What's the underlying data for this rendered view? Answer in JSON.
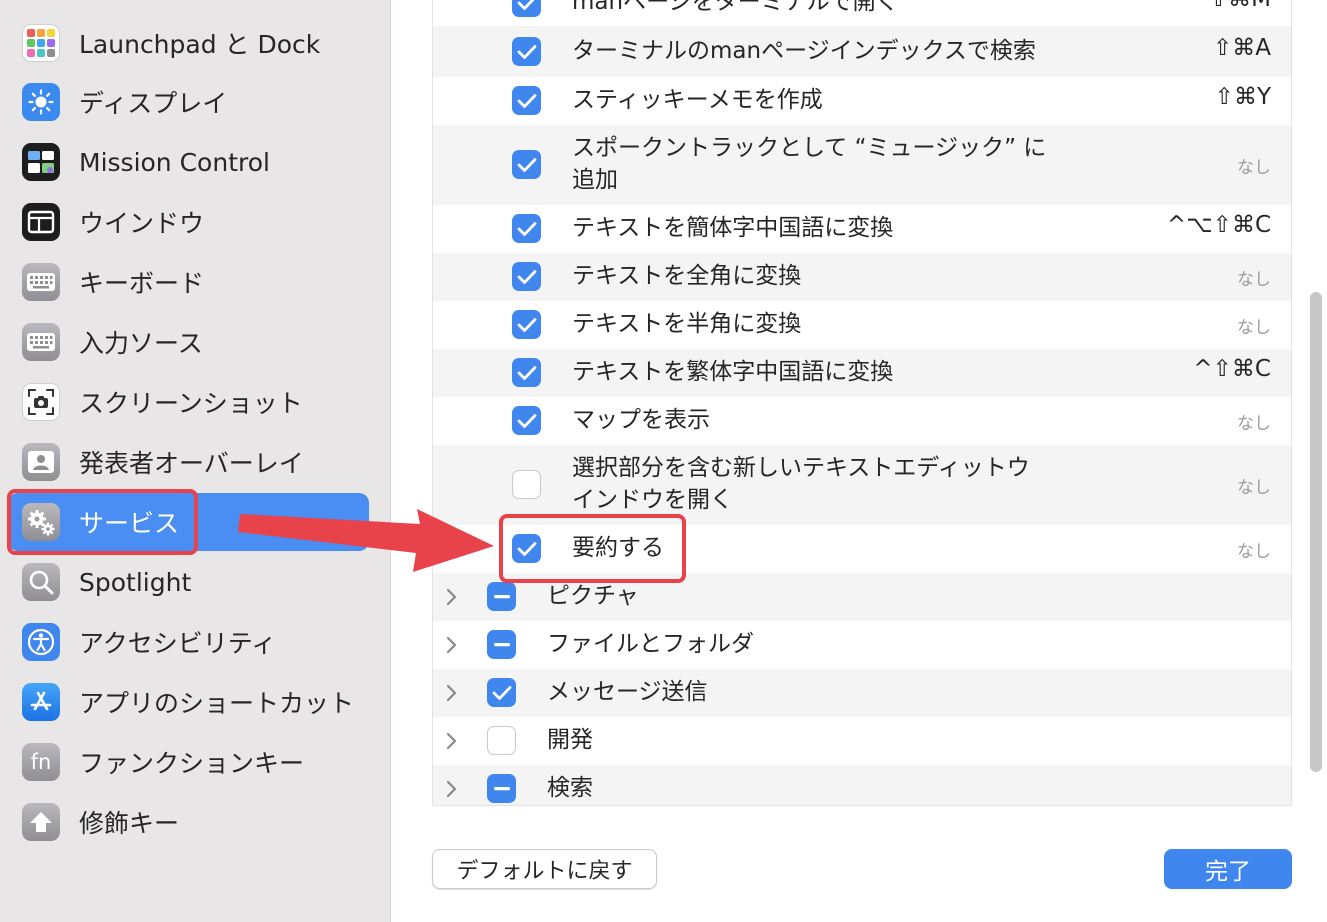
{
  "sidebar": {
    "items": [
      {
        "label": "Launchpad と Dock",
        "icon": "launchpad-icon"
      },
      {
        "label": "ディスプレイ",
        "icon": "sun-icon"
      },
      {
        "label": "Mission Control",
        "icon": "mission-control-icon"
      },
      {
        "label": "ウインドウ",
        "icon": "window-icon"
      },
      {
        "label": "キーボード",
        "icon": "keyboard-icon"
      },
      {
        "label": "入力ソース",
        "icon": "keyboard-icon"
      },
      {
        "label": "スクリーンショット",
        "icon": "camera-icon"
      },
      {
        "label": "発表者オーバーレイ",
        "icon": "presenter-icon"
      },
      {
        "label": "サービス",
        "icon": "gears-icon",
        "selected": true
      },
      {
        "label": "Spotlight",
        "icon": "magnifier-icon"
      },
      {
        "label": "アクセシビリティ",
        "icon": "accessibility-icon"
      },
      {
        "label": "アプリのショートカット",
        "icon": "app-store-icon"
      },
      {
        "label": "ファンクションキー",
        "icon": "fn-icon"
      },
      {
        "label": "修飾キー",
        "icon": "up-arrow-icon"
      }
    ],
    "fn_text": "fn"
  },
  "services": {
    "rows": [
      {
        "label": "manページをターミナルで開く",
        "shortcut": "⇧⌘M",
        "checked": "on"
      },
      {
        "label": "ターミナルのmanページインデックスで検索",
        "shortcut": "⇧⌘A",
        "checked": "on"
      },
      {
        "label": "スティッキーメモを作成",
        "shortcut": "⇧⌘Y",
        "checked": "on"
      },
      {
        "label": "スポークントラックとして “ミュージック” に",
        "label2": "追加",
        "shortcut": "なし",
        "checked": "on"
      },
      {
        "label": "テキストを簡体字中国語に変換",
        "shortcut": "^⌥⇧⌘C",
        "checked": "on"
      },
      {
        "label": "テキストを全角に変換",
        "shortcut": "なし",
        "checked": "on"
      },
      {
        "label": "テキストを半角に変換",
        "shortcut": "なし",
        "checked": "on"
      },
      {
        "label": "テキストを繁体字中国語に変換",
        "shortcut": "^⇧⌘C",
        "checked": "on"
      },
      {
        "label": "マップを表示",
        "shortcut": "なし",
        "checked": "on"
      },
      {
        "label": "選択部分を含む新しいテキストエディットウ",
        "label2": "インドウを開く",
        "shortcut": "なし",
        "checked": "off"
      },
      {
        "label": "要約する",
        "shortcut": "なし",
        "checked": "on"
      }
    ],
    "categories": [
      {
        "label": "ピクチャ",
        "checked": "mixed"
      },
      {
        "label": "ファイルとフォルダ",
        "checked": "mixed"
      },
      {
        "label": "メッセージ送信",
        "checked": "on"
      },
      {
        "label": "開発",
        "checked": "off"
      },
      {
        "label": "検索",
        "checked": "mixed"
      }
    ]
  },
  "buttons": {
    "restore_defaults": "デフォルトに戻す",
    "done": "完了"
  },
  "colors": {
    "accent": "#3f86ee",
    "annotation": "#e8434a"
  }
}
